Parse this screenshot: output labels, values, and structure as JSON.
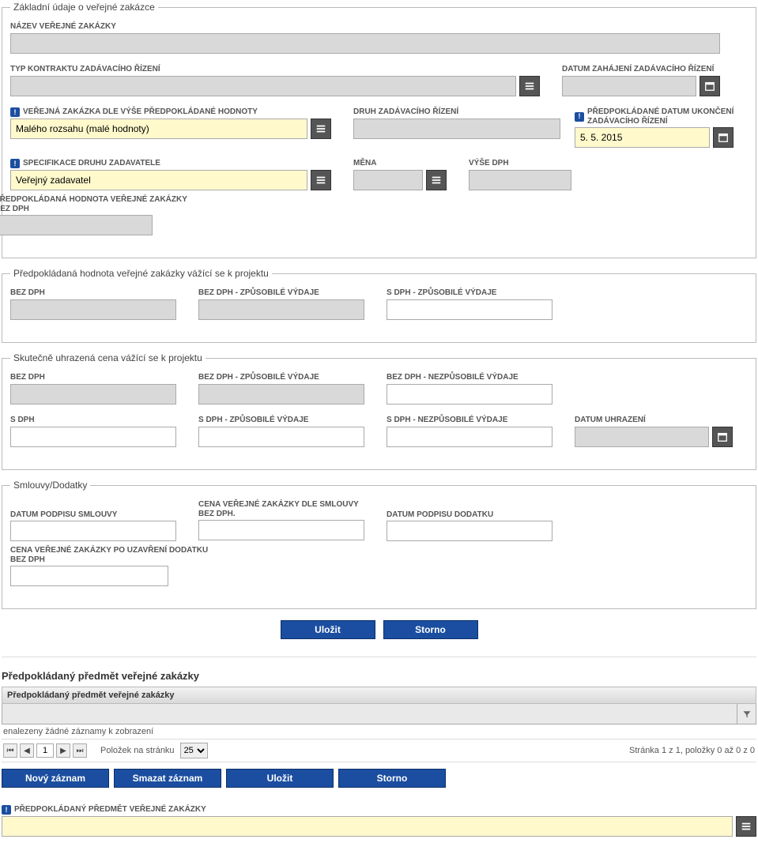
{
  "fieldsets": {
    "basic": {
      "legend": "Základní údaje o veřejné zakázce",
      "name": {
        "label": "NÁZEV VEŘEJNÉ ZAKÁZKY",
        "value": ""
      },
      "contract_type": {
        "label": "TYP KONTRAKTU ZADÁVACÍHO ŘÍZENÍ",
        "value": ""
      },
      "start_date": {
        "label": "DATUM ZAHÁJENÍ ZADÁVACÍHO ŘÍZENÍ",
        "value": ""
      },
      "by_value": {
        "label": "VEŘEJNÁ ZAKÁZKA DLE VÝŠE PŘEDPOKLÁDANÉ HODNOTY",
        "value": "Malého rozsahu (malé hodnoty)"
      },
      "proc_type": {
        "label": "DRUH ZADÁVACÍHO ŘÍZENÍ",
        "value": ""
      },
      "end_date": {
        "label": "PŘEDPOKLÁDANÉ DATUM UKONČENÍ\nZADÁVACÍHO ŘÍZENÍ",
        "value": "5. 5. 2015"
      },
      "spec": {
        "label": "SPECIFIKACE DRUHU ZADAVATELE",
        "value": "Veřejný zadavatel"
      },
      "currency": {
        "label": "MĚNA",
        "value": ""
      },
      "vat_rate": {
        "label": "VÝŠE DPH",
        "value": ""
      },
      "est_value": {
        "label": "PŘEDPOKLÁDANÁ HODNOTA VEŘEJNÉ ZAKÁZKY\nBEZ DPH",
        "value": ""
      }
    },
    "estimated": {
      "legend": "Předpokládaná hodnota veřejné zakázky vážící se k projektu",
      "bez_dph": {
        "label": "BEZ DPH",
        "value": ""
      },
      "bez_dph_zp": {
        "label": "BEZ DPH - ZPŮSOBILÉ VÝDAJE",
        "value": ""
      },
      "s_dph_zp": {
        "label": "S DPH - ZPŮSOBILÉ VÝDAJE",
        "value": ""
      }
    },
    "actual": {
      "legend": "Skutečně uhrazená cena vážící se k projektu",
      "bez_dph": {
        "label": "BEZ DPH",
        "value": ""
      },
      "bez_dph_zp": {
        "label": "BEZ DPH - ZPŮSOBILÉ VÝDAJE",
        "value": ""
      },
      "bez_dph_nezp": {
        "label": "BEZ DPH - NEZPŮSOBILÉ VÝDAJE",
        "value": ""
      },
      "s_dph": {
        "label": "S DPH",
        "value": ""
      },
      "s_dph_zp": {
        "label": "S DPH - ZPŮSOBILÉ VÝDAJE",
        "value": ""
      },
      "s_dph_nezp": {
        "label": "S DPH - NEZPŮSOBILÉ VÝDAJE",
        "value": ""
      },
      "paid_date": {
        "label": "DATUM UHRAZENÍ",
        "value": ""
      }
    },
    "contracts": {
      "legend": "Smlouvy/Dodatky",
      "sign_date": {
        "label": "DATUM PODPISU SMLOUVY",
        "value": ""
      },
      "price_contract": {
        "label": "CENA VEŘEJNÉ ZAKÁZKY DLE SMLOUVY\nBEZ DPH.",
        "value": ""
      },
      "addendum_date": {
        "label": "DATUM PODPISU DODATKU",
        "value": ""
      },
      "price_addendum": {
        "label": "CENA VEŘEJNÉ ZAKÁZKY PO UZAVŘENÍ DODATKU\nBEZ DPH",
        "value": ""
      }
    }
  },
  "buttons": {
    "save": "Uložit",
    "cancel": "Storno",
    "new": "Nový záznam",
    "delete": "Smazat záznam"
  },
  "subject": {
    "title": "Předpokládaný předmět veřejné zakázky",
    "grid_header": "Předpokládaný předmět veřejné zakázky",
    "empty": "enalezeny žádné záznamy k zobrazení",
    "per_page_label": "Položek na stránku",
    "per_page_value": "25",
    "page_current": "1",
    "pager_info": "Stránka 1 z 1, položky 0 až 0 z 0",
    "field": {
      "label": "PŘEDPOKLÁDANÝ PŘEDMĚT VEŘEJNÉ ZAKÁZKY",
      "value": ""
    }
  },
  "req_mark": "!"
}
